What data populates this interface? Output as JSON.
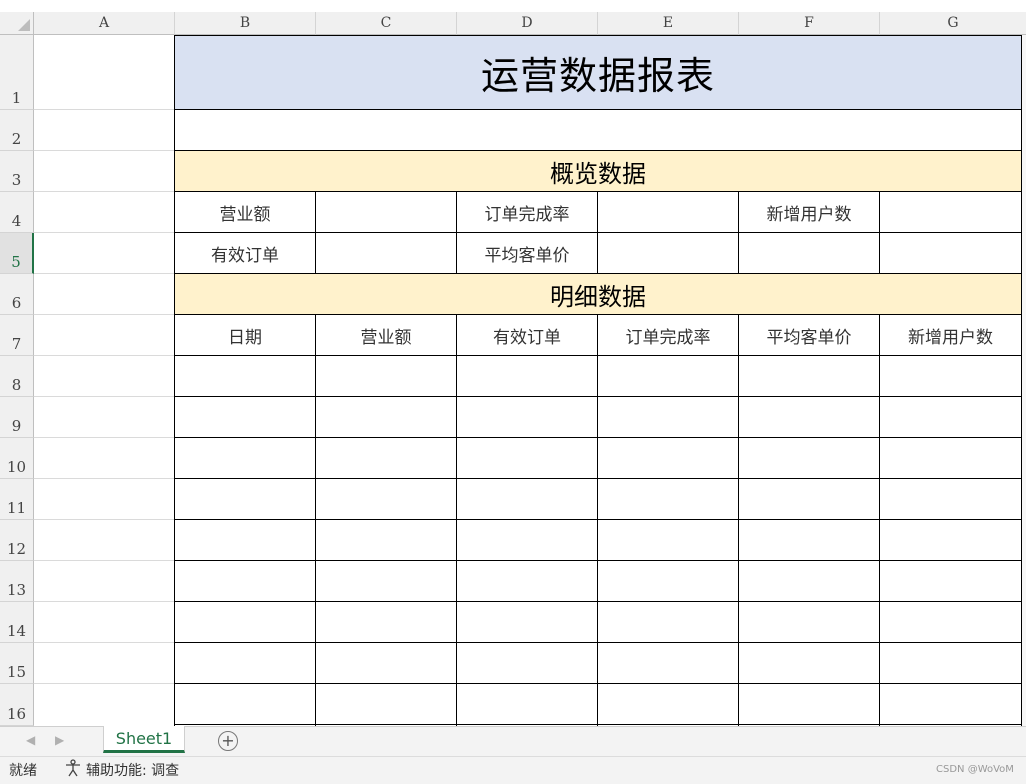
{
  "columns": [
    "A",
    "B",
    "C",
    "D",
    "E",
    "F",
    "G"
  ],
  "rows": [
    "1",
    "2",
    "3",
    "4",
    "5",
    "6",
    "7",
    "8",
    "9",
    "10",
    "11",
    "12",
    "13",
    "14",
    "15",
    "16"
  ],
  "selected_row": "5",
  "report": {
    "title": "运营数据报表",
    "overview_title": "概览数据",
    "overview": {
      "revenue_label": "营业额",
      "completion_rate_label": "订单完成率",
      "new_users_label": "新增用户数",
      "valid_orders_label": "有效订单",
      "avg_price_label": "平均客单价"
    },
    "detail_title": "明细数据",
    "detail_headers": [
      "日期",
      "营业额",
      "有效订单",
      "订单完成率",
      "平均客单价",
      "新增用户数"
    ]
  },
  "sheet": {
    "tab_label": "Sheet1",
    "add_icon": "plus-circle-icon"
  },
  "status": {
    "ready": "就绪",
    "accessibility": "辅助功能: 调查",
    "watermark": "CSDN @WoVoM"
  },
  "colors": {
    "title_fill": "#d9e1f2",
    "section_fill": "#fff2cc",
    "accent": "#217346"
  }
}
